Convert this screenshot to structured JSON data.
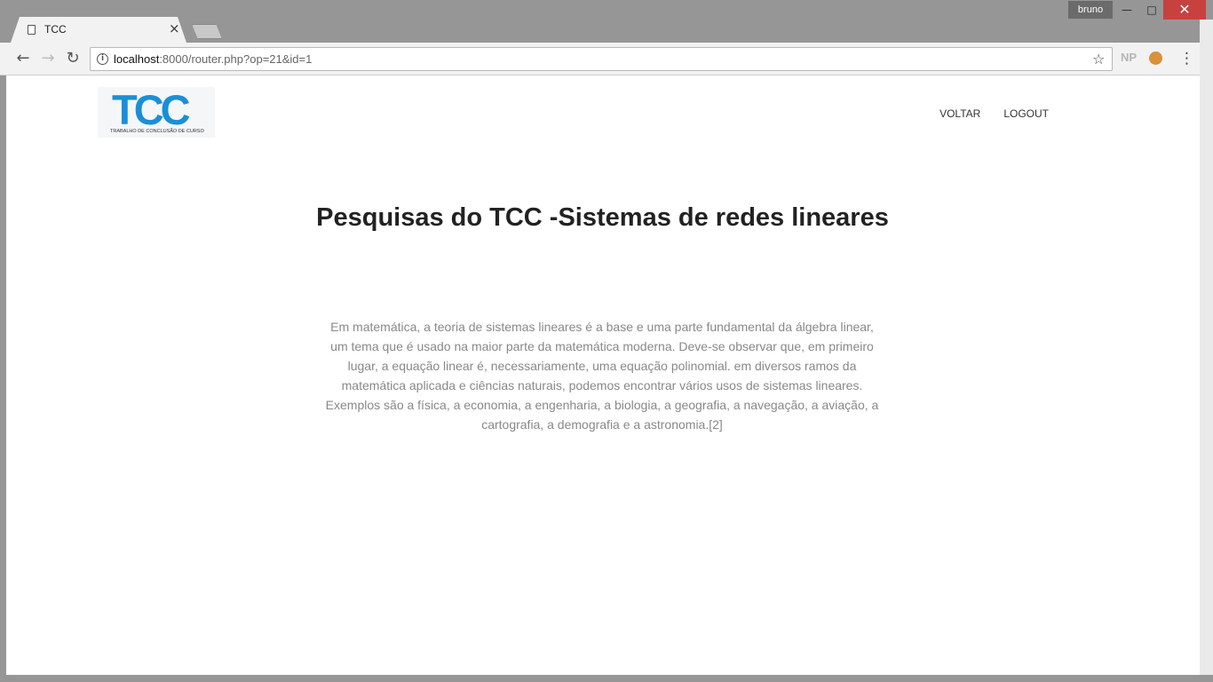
{
  "browser": {
    "user_badge": "bruno",
    "tab": {
      "title": "TCC",
      "close": "×"
    },
    "address": {
      "host": "localhost",
      "rest": ":8000/router.php?op=21&id=1"
    },
    "extension_np": "NP"
  },
  "site": {
    "logo": {
      "mark": "TCC",
      "subtitle": "TRABALHO DE CONCLUSÃO DE CURSO"
    },
    "nav": {
      "voltar": "VOLTAR",
      "logout": "LOGOUT"
    },
    "heading": "Pesquisas do TCC -Sistemas de redes lineares",
    "body": "Em matemática, a teoria de sistemas lineares é a base e uma parte fundamental da álgebra linear, um tema que é usado na maior parte da matemática moderna. Deve-se observar que, em primeiro lugar, a equação linear é, necessariamente, uma equação polinomial. em diversos ramos da matemática aplicada e ciências naturais, podemos encontrar vários usos de sistemas lineares. Exemplos são a física, a economia, a engenharia, a biologia, a geografia, a navegação, a aviação, a cartografia, a demografia e a astronomia.[2]"
  }
}
